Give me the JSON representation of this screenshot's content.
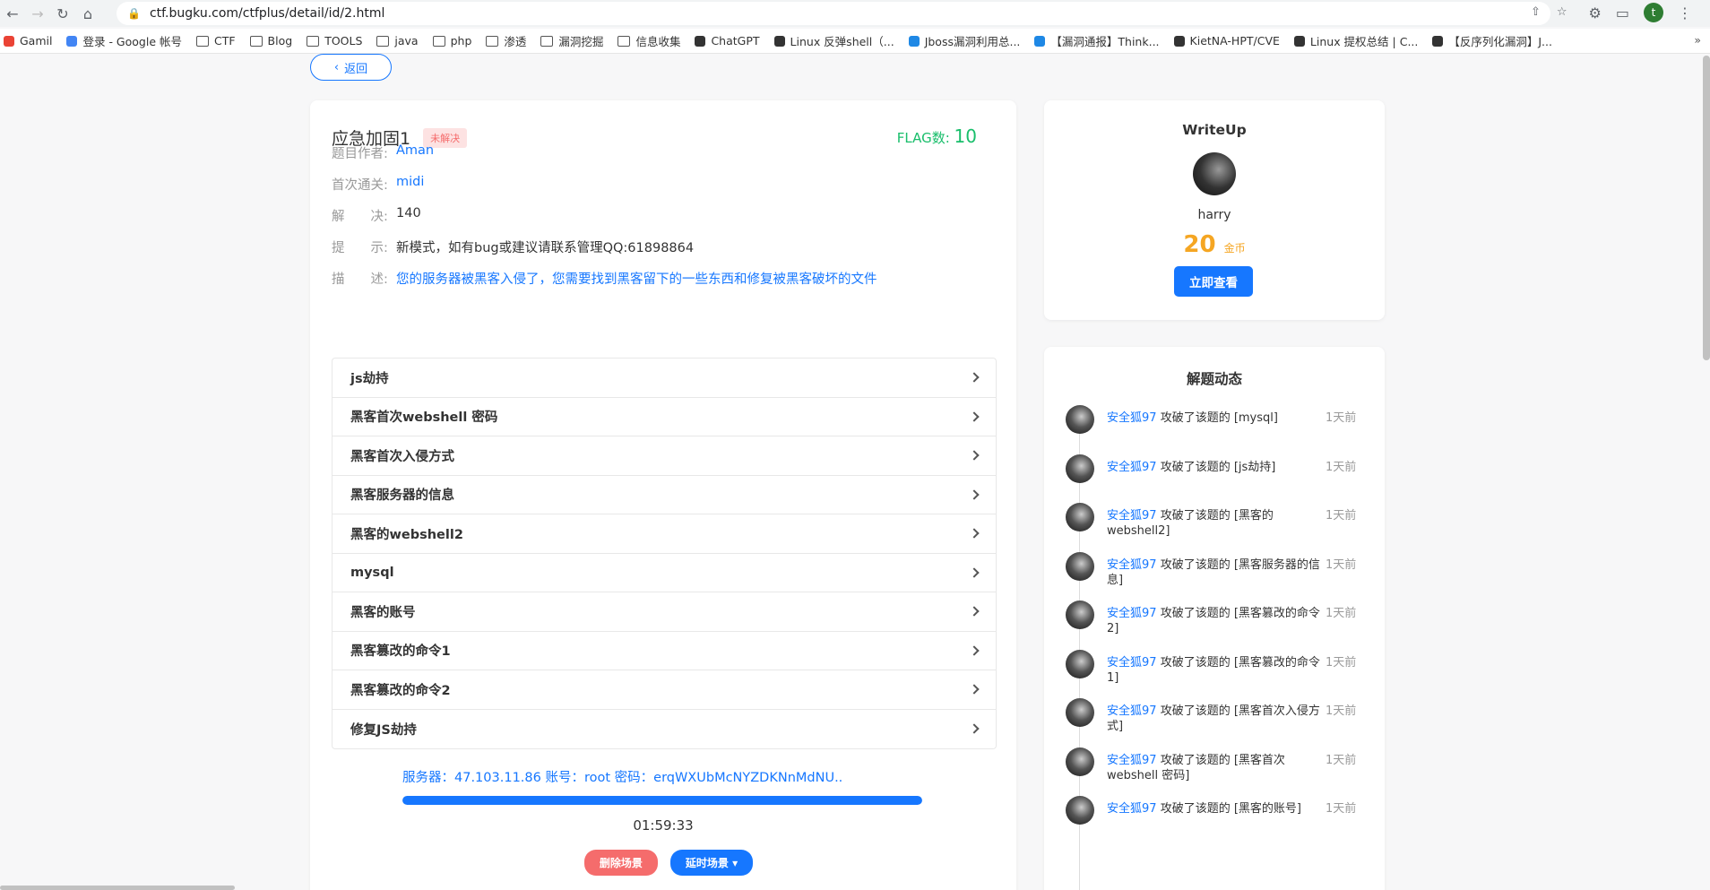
{
  "browser": {
    "url": "ctf.bugku.com/ctfplus/detail/id/2.html",
    "profile_initial": "t",
    "bookmarks": [
      {
        "label": "Gamil",
        "icon": "gmail-icon"
      },
      {
        "label": "登录 - Google 帐号",
        "icon": "google-icon"
      },
      {
        "label": "CTF",
        "icon": "folder-icon"
      },
      {
        "label": "Blog",
        "icon": "folder-icon"
      },
      {
        "label": "TOOLS",
        "icon": "folder-icon"
      },
      {
        "label": "java",
        "icon": "folder-icon"
      },
      {
        "label": "php",
        "icon": "folder-icon"
      },
      {
        "label": "渗透",
        "icon": "folder-icon"
      },
      {
        "label": "漏洞挖掘",
        "icon": "folder-icon"
      },
      {
        "label": "信息收集",
        "icon": "folder-icon"
      },
      {
        "label": "ChatGPT",
        "icon": "chatgpt-icon"
      },
      {
        "label": "Linux 反弹shell（...",
        "icon": "site-icon"
      },
      {
        "label": "Jboss漏洞利用总...",
        "icon": "cloud-icon"
      },
      {
        "label": "【漏洞通报】Think...",
        "icon": "cloud-icon"
      },
      {
        "label": "KietNA-HPT/CVE",
        "icon": "github-icon"
      },
      {
        "label": "Linux 提权总结 | C...",
        "icon": "site-icon"
      },
      {
        "label": "【反序列化漏洞】J...",
        "icon": "notion-icon"
      }
    ]
  },
  "page": {
    "back_label": "返回",
    "title": "应急加固1",
    "status_badge": "未解决",
    "flag_label": "FLAG数:",
    "flag_count": "10",
    "info": [
      {
        "key": "题目作者:",
        "value": "Aman",
        "link": true
      },
      {
        "key": "首次通关:",
        "value": "midi",
        "link": true
      },
      {
        "key": "解　　决:",
        "value": "140",
        "link": false
      },
      {
        "key": "提　　示:",
        "value": "新模式，如有bug或建议请联系管理QQ:61898864",
        "link": false
      },
      {
        "key": "描　　述:",
        "value": "您的服务器被黑客入侵了，您需要找到黑客留下的一些东西和修复被黑客破坏的文件",
        "link": true
      }
    ],
    "tasks": [
      "js劫持",
      "黑客首次webshell 密码",
      "黑客首次入侵方式",
      "黑客服务器的信息",
      "黑客的webshell2",
      "mysql",
      "黑客的账号",
      "黑客篡改的命令1",
      "黑客篡改的命令2",
      "修复JS劫持"
    ],
    "server_info": "服务器：47.103.11.86 账号：root 密码：erqWXUbMcNYZDKNnMdNU..",
    "progress_fraction": 1.0,
    "timer": "01:59:33",
    "delete_label": "删除场景",
    "extend_label": "延时场景 ▾"
  },
  "writeup": {
    "title": "WriteUp",
    "author": "harry",
    "coins": "20",
    "coin_unit": "金币",
    "view_label": "立即查看"
  },
  "activity": {
    "title": "解题动态",
    "items": [
      {
        "user": "安全狐97",
        "text": "攻破了该题的 [mysql]",
        "time": "1天前"
      },
      {
        "user": "安全狐97",
        "text": "攻破了该题的 [js劫持]",
        "time": "1天前"
      },
      {
        "user": "安全狐97",
        "text": "攻破了该题的 [黑客的webshell2]",
        "time": "1天前"
      },
      {
        "user": "安全狐97",
        "text": "攻破了该题的 [黑客服务器的信息]",
        "time": "1天前"
      },
      {
        "user": "安全狐97",
        "text": "攻破了该题的 [黑客篡改的命令2]",
        "time": "1天前"
      },
      {
        "user": "安全狐97",
        "text": "攻破了该题的 [黑客篡改的命令1]",
        "time": "1天前"
      },
      {
        "user": "安全狐97",
        "text": "攻破了该题的 [黑客首次入侵方式]",
        "time": "1天前"
      },
      {
        "user": "安全狐97",
        "text": "攻破了该题的 [黑客首次webshell 密码]",
        "time": "1天前"
      },
      {
        "user": "安全狐97",
        "text": "攻破了该题的 [黑客的账号]",
        "time": "1天前"
      }
    ]
  }
}
